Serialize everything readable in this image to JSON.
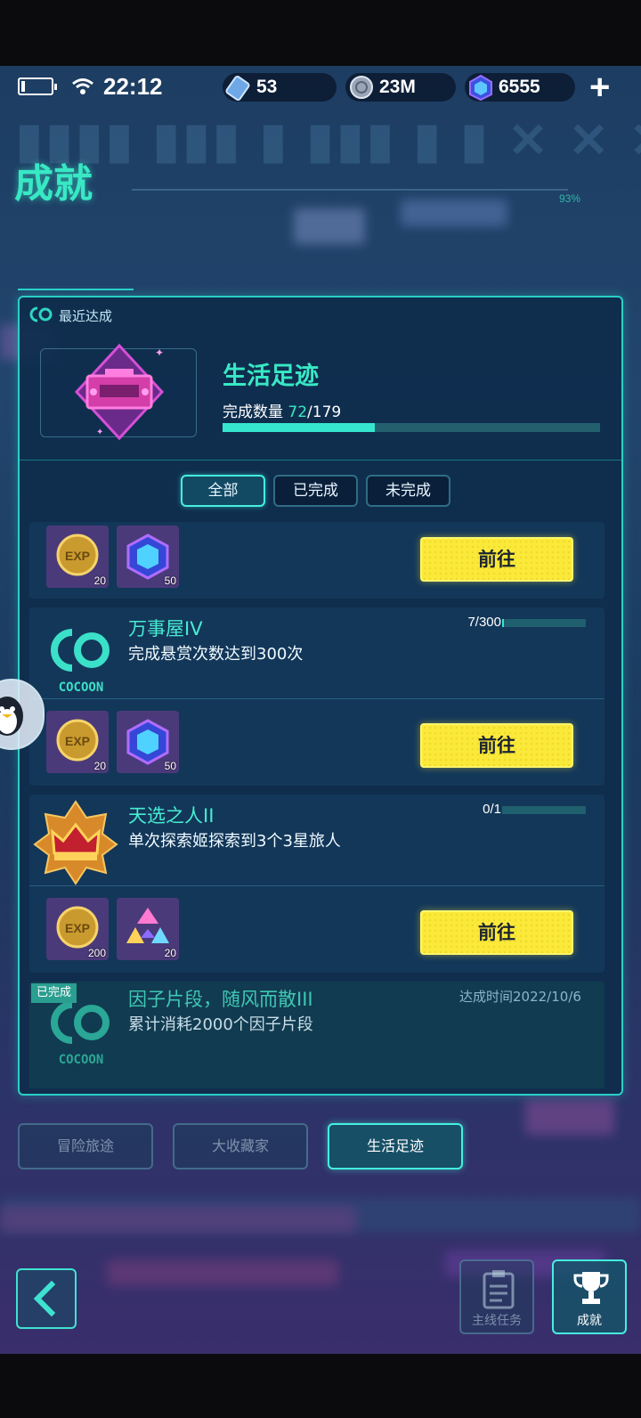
{
  "status": {
    "time": "22:12",
    "resources": [
      {
        "icon": "ticket-icon",
        "value": "53"
      },
      {
        "icon": "coin-icon",
        "value": "23M"
      },
      {
        "icon": "gem-icon",
        "value": "6555"
      }
    ],
    "battery_level": 0.1
  },
  "header": {
    "title": "成就",
    "progress_text": "93%"
  },
  "recent": {
    "label": "最近达成",
    "category_title": "生活足迹",
    "count_label": "完成数量",
    "count_done": "72",
    "count_total": "/179",
    "progress_fraction": 0.403
  },
  "filters": [
    {
      "label": "全部",
      "active": true
    },
    {
      "label": "已完成",
      "active": false
    },
    {
      "label": "未完成",
      "active": false
    }
  ],
  "achievements": [
    {
      "name": "",
      "rewards": [
        {
          "icon": "exp-coin-icon",
          "qty": "20"
        },
        {
          "icon": "crystal-cube-icon",
          "qty": "50"
        }
      ],
      "button": "前往"
    },
    {
      "name": "万事屋IV",
      "desc": "完成悬赏次数达到300次",
      "progress_text": "7/300",
      "progress_fraction": 0.023,
      "icon": "cocoon-logo-icon",
      "rewards": [
        {
          "icon": "exp-coin-icon",
          "qty": "20"
        },
        {
          "icon": "crystal-cube-icon",
          "qty": "50"
        }
      ],
      "button": "前往"
    },
    {
      "name": "天选之人II",
      "desc": "单次探索姬探索到3个3星旅人",
      "progress_text": "0/1",
      "progress_fraction": 0,
      "icon": "crown-badge-icon",
      "rewards": [
        {
          "icon": "exp-coin-icon",
          "qty": "200"
        },
        {
          "icon": "prism-shard-icon",
          "qty": "20"
        }
      ],
      "button": "前往"
    },
    {
      "name": "因子片段，随风而散III",
      "desc": "累计消耗2000个因子片段",
      "tag": "已完成",
      "done_time": "达成时间2022/10/6",
      "icon": "cocoon-logo-icon"
    }
  ],
  "cocoon_text": "COCOON",
  "category_tabs": [
    {
      "label": "冒险旅途",
      "active": false
    },
    {
      "label": "大收藏家",
      "active": false
    },
    {
      "label": "生活足迹",
      "active": true
    }
  ],
  "nav": [
    {
      "label": "主线任务",
      "icon": "clipboard-icon",
      "active": false
    },
    {
      "label": "成就",
      "icon": "trophy-icon",
      "active": true
    }
  ],
  "colors": {
    "accent": "#38e8c4",
    "button": "#fbe93a",
    "panel_border": "#29d0c6"
  }
}
